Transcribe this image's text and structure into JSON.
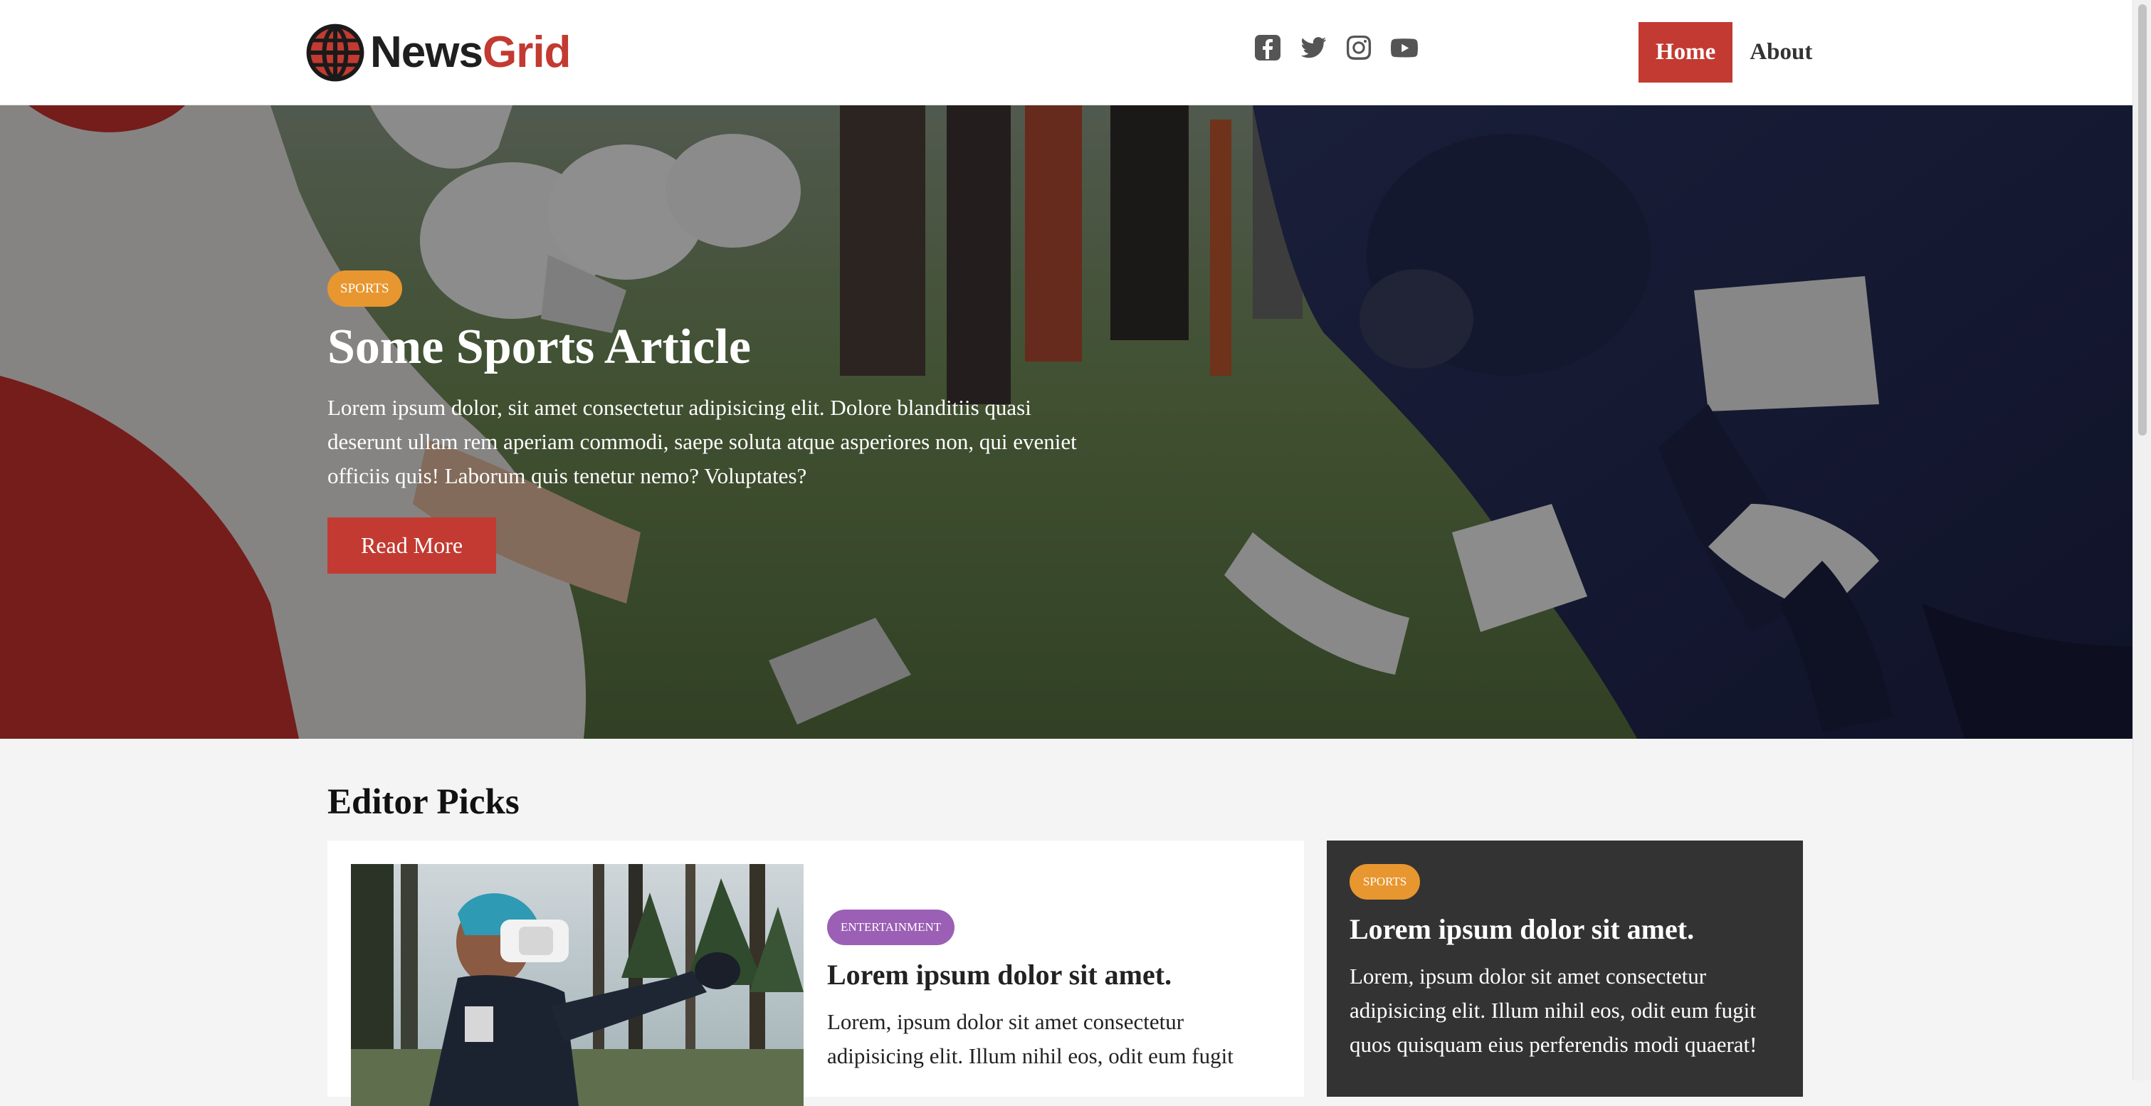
{
  "brand": {
    "name_part1": "News",
    "name_part2": "Grid",
    "logo_icon": "globe-icon",
    "accent_color": "#c23a31"
  },
  "socials": [
    {
      "name": "facebook-icon"
    },
    {
      "name": "twitter-icon"
    },
    {
      "name": "instagram-icon"
    },
    {
      "name": "youtube-icon"
    }
  ],
  "nav": {
    "items": [
      {
        "label": "Home",
        "active": true
      },
      {
        "label": "About",
        "active": false
      }
    ]
  },
  "hero": {
    "category": "SPORTS",
    "title": "Some Sports Article",
    "text": "Lorem ipsum dolor, sit amet consectetur adipisicing elit. Dolore blanditiis quasi deserunt ullam rem aperiam commodi, saepe soluta atque asperiores non, qui eveniet officiis quis! Laborum quis tenetur nemo? Voluptates?",
    "button_label": "Read More",
    "image": "football-players-photo"
  },
  "editor_picks": {
    "title": "Editor Picks",
    "cards": [
      {
        "category": "ENTERTAINMENT",
        "title": "Lorem ipsum dolor sit amet.",
        "text": "Lorem, ipsum dolor sit amet consectetur adipisicing elit. Illum nihil eos, odit eum fugit",
        "image": "vr-headset-man-photo"
      },
      {
        "category": "SPORTS",
        "title": "Lorem ipsum dolor sit amet.",
        "text": "Lorem, ipsum dolor sit amet consectetur adipisicing elit. Illum nihil eos, odit eum fugit quos quisquam eius perferendis modi quaerat!"
      }
    ]
  },
  "colors": {
    "sports_badge": "#e8962f",
    "entertainment_badge": "#9b5fb5",
    "dark_card": "#333333"
  }
}
